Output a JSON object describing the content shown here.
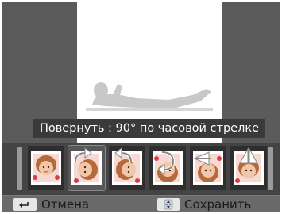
{
  "caption": "Повернуть : 90° по часовой стрелке",
  "thumbnails": [
    {
      "name": "thumb-original",
      "icon": "none"
    },
    {
      "name": "thumb-rotate-right-90",
      "icon": "rotate-clockwise-icon",
      "selected": true
    },
    {
      "name": "thumb-rotate-left-90",
      "icon": "rotate-counterclockwise-icon"
    },
    {
      "name": "thumb-rotate-180",
      "icon": "rotate-180-icon"
    },
    {
      "name": "thumb-flip-vertical",
      "icon": "flip-vertical-icon"
    },
    {
      "name": "thumb-flip-horizontal",
      "icon": "flip-horizontal-icon"
    }
  ],
  "bottom_bar": {
    "cancel_key_icon": "back-arrow-icon",
    "cancel_label": "Отмена",
    "save_key_icon": "dpad-icon",
    "save_label": "Сохранить"
  },
  "colors": {
    "background": "#5b5b5b",
    "preview": "#ffffff",
    "strip": "#444444",
    "caption_bg": "#3a3a3a"
  }
}
